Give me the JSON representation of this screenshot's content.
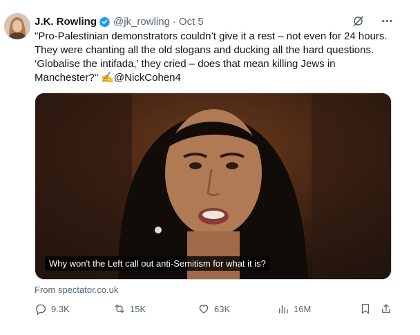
{
  "tweet": {
    "author_name": "J.K. Rowling",
    "handle": "@jk_rowling",
    "separator": "·",
    "timestamp": "Oct 5",
    "text": "\"Pro-Palestinian demonstrators couldn’t give it a rest – not even for 24 hours. They were chanting all the old slogans and ducking all the hard questions. ‘Globalise the intifada,’ they cried – does that mean killing Jews in Manchester?\" ✍️@NickCohen4",
    "card_caption": "Why won't the Left call out anti-Semitism for what it is?",
    "card_source": "From spectator.co.uk",
    "replies": "9.3K",
    "reposts": "15K",
    "likes": "63K",
    "views": "16M"
  },
  "colors": {
    "verified": "#1d9bf0",
    "muted": "#536471",
    "text": "#0f1419"
  },
  "icons": [
    "verified-badge-icon",
    "grok-icon",
    "more-icon",
    "reply-icon",
    "repost-icon",
    "like-icon",
    "views-icon",
    "bookmark-icon",
    "share-icon"
  ]
}
